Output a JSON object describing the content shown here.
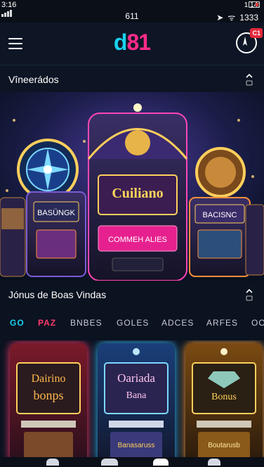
{
  "status_bar": {
    "time": "3:16",
    "center": "611",
    "right_top": "1:14:",
    "right_bottom": "1333"
  },
  "header": {
    "logo_part1": "d",
    "logo_part2": "81",
    "account_badge": "C1"
  },
  "section1": {
    "title": "Vîneerádos"
  },
  "hero": {
    "center_machine_title": "Cuiliano",
    "center_machine_cta": "COMMEH ALIES",
    "left_machine_title": "BASÜNGK",
    "right_machine_title": "BACISNC"
  },
  "section2": {
    "title": "Jónus de Boas Vindas"
  },
  "tabs": [
    "GO",
    "PAZ",
    "BNBES",
    "GOLES",
    "ADCES",
    "ARFES",
    "OO"
  ],
  "cards": [
    {
      "title_line1": "Dairino",
      "title_line2": "bonps",
      "bottom": ""
    },
    {
      "title_line1": "Oariada",
      "title_line2": "Bana",
      "bottom": "Banasaruss"
    },
    {
      "title_line1": "Bonus",
      "title_line2": "",
      "bottom": "Boutarusb"
    }
  ],
  "colors": {
    "accent_cyan": "#19d2ee",
    "accent_pink": "#ff2b8a",
    "tab_active": "#19d2ee",
    "tab_red": "#ff3a6e"
  }
}
